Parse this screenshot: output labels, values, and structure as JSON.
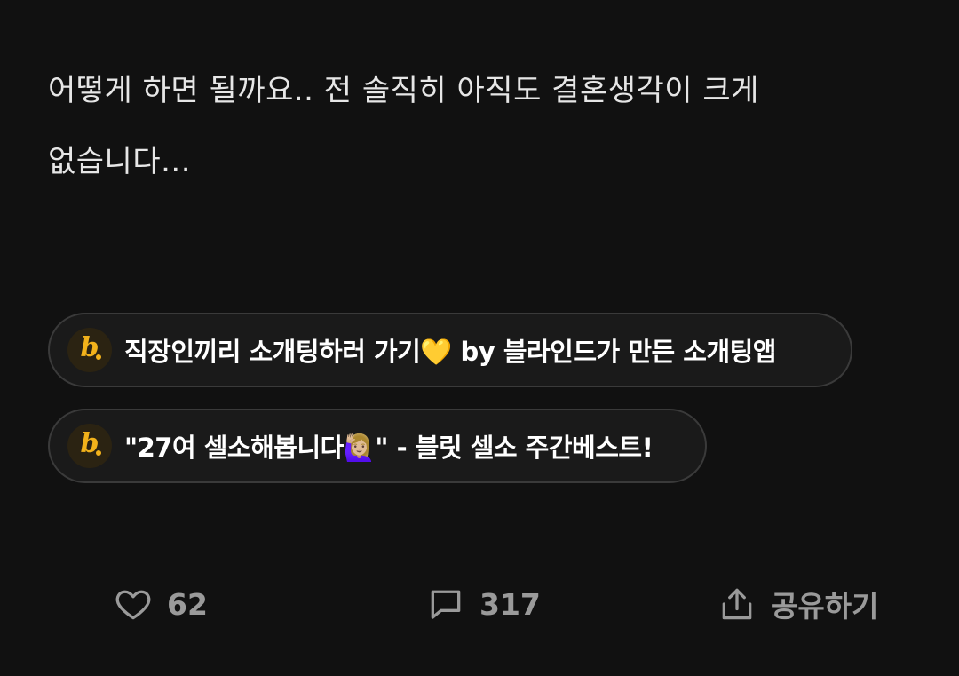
{
  "post": {
    "line1": "어떻게 하면 될까요.. 전 솔직히 아직도 결혼생각이 크게",
    "line2": "없습니다..."
  },
  "promos": [
    {
      "badge_letter": "b",
      "text": "직장인끼리 소개팅하러 가기💛 by 블라인드가 만든 소개팅앱",
      "icon": "blind-logo-icon"
    },
    {
      "badge_letter": "b",
      "text": "\"27여 셀소해봅니다🙋🏼‍♀️\" - 블릿 셀소 주간베스트!",
      "icon": "blind-logo-icon"
    }
  ],
  "actions": {
    "like": {
      "icon": "heart-icon",
      "count": "62"
    },
    "comment": {
      "icon": "comment-icon",
      "count": "317"
    },
    "share": {
      "icon": "share-icon",
      "label": "공유하기"
    }
  },
  "colors": {
    "background": "#111111",
    "text": "#e6e6e6",
    "muted": "#9a9a9a",
    "brand": "#f2b21b"
  }
}
